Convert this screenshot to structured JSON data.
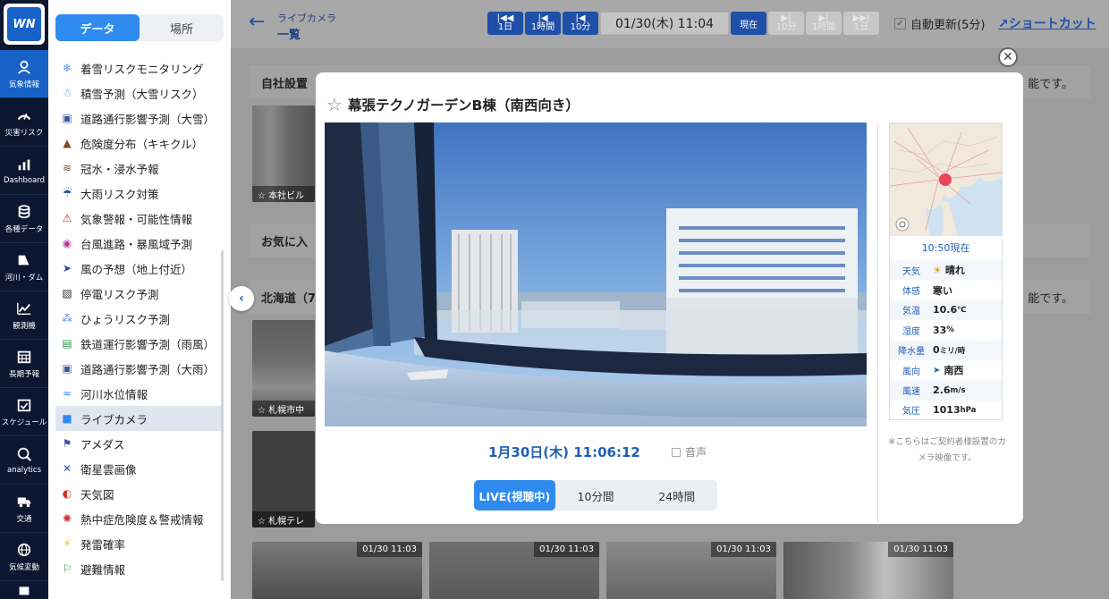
{
  "logo": "WN",
  "rail": [
    {
      "label": "気象情報",
      "icon": "weather-pin-icon",
      "active": true
    },
    {
      "label": "災害リスク",
      "icon": "gauge-icon"
    },
    {
      "label": "Dashboard",
      "icon": "bar-chart-icon"
    },
    {
      "label": "各種データ",
      "icon": "database-icon"
    },
    {
      "label": "河川・ダム",
      "icon": "dam-icon"
    },
    {
      "label": "観測機",
      "icon": "line-chart-icon"
    },
    {
      "label": "長期予報",
      "icon": "calendar-grid-icon"
    },
    {
      "label": "スケジュール",
      "icon": "calendar-check-icon"
    },
    {
      "label": "analytics",
      "icon": "analytics-icon"
    },
    {
      "label": "交通",
      "icon": "truck-icon"
    },
    {
      "label": "気候変動",
      "icon": "globe-icon"
    }
  ],
  "menu": {
    "tabs": [
      "データ",
      "場所"
    ],
    "items": [
      {
        "label": "着雪リスクモニタリング",
        "icon": "snow-wind-icon",
        "color": "#5b8fd6"
      },
      {
        "label": "積雪予測（大雪リスク）",
        "icon": "snow-person-icon",
        "color": "#5b8fd6"
      },
      {
        "label": "道路通行影響予測（大雪）",
        "icon": "car-snow-icon",
        "color": "#3a5a9c"
      },
      {
        "label": "危険度分布（キキクル）",
        "icon": "landslide-icon",
        "color": "#7b4a2a"
      },
      {
        "label": "冠水・浸水予報",
        "icon": "flood-car-icon",
        "color": "#7b4a2a"
      },
      {
        "label": "大雨リスク対策",
        "icon": "heavy-rain-icon",
        "color": "#1f4fa6"
      },
      {
        "label": "気象警報・可能性情報",
        "icon": "warning-icon",
        "color": "#d62828"
      },
      {
        "label": "台風進路・暴風域予測",
        "icon": "typhoon-icon",
        "color": "#b03a9c"
      },
      {
        "label": "風の予想（地上付近）",
        "icon": "wind-arrow-icon",
        "color": "#1f4fa6"
      },
      {
        "label": "停電リスク予測",
        "icon": "power-outage-icon",
        "color": "#333"
      },
      {
        "label": "ひょうリスク予測",
        "icon": "hail-icon",
        "color": "#5b8fd6"
      },
      {
        "label": "鉄道運行影響予測（雨風）",
        "icon": "train-icon",
        "color": "#2a9a4a"
      },
      {
        "label": "道路通行影響予測（大雨）",
        "icon": "car-rain-icon",
        "color": "#3a5a9c"
      },
      {
        "label": "河川水位情報",
        "icon": "river-icon",
        "color": "#2f8bf0"
      },
      {
        "label": "ライブカメラ",
        "icon": "video-camera-icon",
        "color": "#2f8bf0",
        "selected": true
      },
      {
        "label": "アメダス",
        "icon": "amedas-icon",
        "color": "#3a5a9c"
      },
      {
        "label": "衛星雲画像",
        "icon": "satellite-icon",
        "color": "#1f4fa6"
      },
      {
        "label": "天気図",
        "icon": "weather-map-icon",
        "color": "#d62828"
      },
      {
        "label": "熱中症危険度＆警戒情報",
        "icon": "heat-sun-icon",
        "color": "#d62828"
      },
      {
        "label": "発雷確率",
        "icon": "lightning-icon",
        "color": "#e0b000"
      },
      {
        "label": "避難情報",
        "icon": "evacuation-icon",
        "color": "#2a9a4a"
      }
    ]
  },
  "topbar": {
    "breadcrumb_top": "ライブカメラ",
    "breadcrumb_main": "一覧",
    "step_back": [
      {
        "label": "1日",
        "arrow": "|◀◀"
      },
      {
        "label": "1時間",
        "arrow": "|◀"
      },
      {
        "label": "10分",
        "arrow": "|◀"
      }
    ],
    "current_time": "01/30(木) 11:04",
    "now_label": "現在",
    "step_forward": [
      {
        "label": "10分",
        "arrow": "▶|"
      },
      {
        "label": "1時間",
        "arrow": "▶|"
      },
      {
        "label": "1日",
        "arrow": "▶▶|"
      }
    ],
    "auto_update": "自動更新(5分)",
    "shortcut": "ショートカット"
  },
  "background": {
    "sections": [
      {
        "title": "自社設置",
        "right": "能です。"
      },
      {
        "title": "お気に入",
        "right": ""
      },
      {
        "title": "北海道（7",
        "right": "能です。"
      }
    ],
    "thumbs": [
      {
        "caption": "☆ 本社ビル"
      },
      {
        "caption": "☆ 札幌市中"
      },
      {
        "caption": "☆ 札幌テレ"
      }
    ],
    "bottom_times": [
      "01/30 11:03",
      "01/30 11:03",
      "01/30 11:03",
      "01/30 11:03"
    ]
  },
  "modal": {
    "title": "幕張テクノガーデンB棟（南西向き）",
    "datetime": "1月30日(木) 11:06:12",
    "sound": "音声",
    "segments": [
      "LIVE(視聴中)",
      "10分間",
      "24時間"
    ],
    "side": {
      "now": "10:50現在",
      "rows": [
        {
          "key": "天気",
          "value": "晴れ",
          "icon": "sun-icon"
        },
        {
          "key": "体感",
          "value": "寒い"
        },
        {
          "key": "気温",
          "value": "10.6",
          "unit": "℃"
        },
        {
          "key": "湿度",
          "value": "33",
          "unit": "%"
        },
        {
          "key": "降水量",
          "value": "0",
          "unit": "ミリ/時"
        },
        {
          "key": "風向",
          "value": "南西",
          "icon": "wind-direction-icon"
        },
        {
          "key": "風速",
          "value": "2.6",
          "unit": "m/s"
        },
        {
          "key": "気圧",
          "value": "1013",
          "unit": "hPa"
        }
      ],
      "note": "※こちらはご契約者様設置のカメラ映像です。"
    }
  }
}
